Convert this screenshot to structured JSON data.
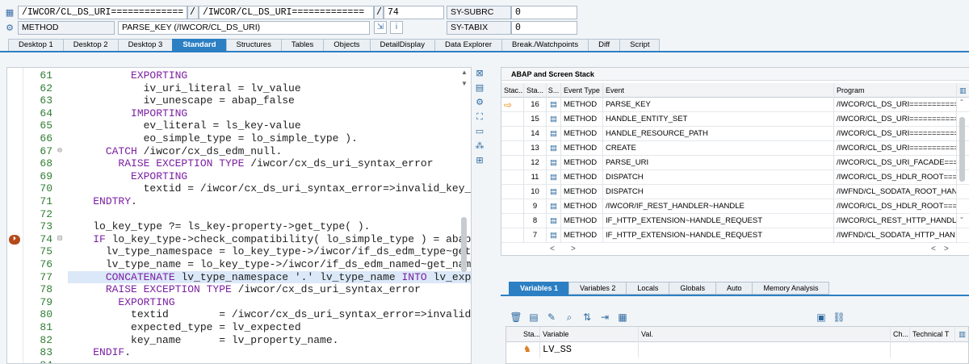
{
  "header": {
    "row1": {
      "program_field": "/IWCOR/CL_DS_URI=============",
      "include_field": "/IWCOR/CL_DS_URI=============",
      "line_field": "74",
      "sysvar_label": "SY-SUBRC",
      "sysvar_value": "0"
    },
    "row2": {
      "event_type": "METHOD",
      "event_name": "PARSE_KEY (/IWCOR/CL_DS_URI)",
      "sysvar_label": "SY-TABIX",
      "sysvar_value": "0"
    }
  },
  "tabs": [
    "Desktop 1",
    "Desktop 2",
    "Desktop 3",
    "Standard",
    "Structures",
    "Tables",
    "Objects",
    "DetailDisplay",
    "Data Explorer",
    "Break./Watchpoints",
    "Diff",
    "Script"
  ],
  "active_tab": "Standard",
  "code": [
    {
      "n": "61",
      "fold": "",
      "indent": "          ",
      "parts": [
        [
          "kw",
          "EXPORTING"
        ]
      ]
    },
    {
      "n": "62",
      "fold": "",
      "indent": "            ",
      "parts": [
        [
          "",
          "iv_uri_literal = lv_value"
        ]
      ]
    },
    {
      "n": "63",
      "fold": "",
      "indent": "            ",
      "parts": [
        [
          "",
          "iv_unescape = abap_false"
        ]
      ]
    },
    {
      "n": "64",
      "fold": "",
      "indent": "          ",
      "parts": [
        [
          "kw",
          "IMPORTING"
        ]
      ]
    },
    {
      "n": "65",
      "fold": "",
      "indent": "            ",
      "parts": [
        [
          "",
          "ev_literal = ls_key-value"
        ]
      ]
    },
    {
      "n": "66",
      "fold": "",
      "indent": "            ",
      "parts": [
        [
          "",
          "eo_simple_type = lo_simple_type )."
        ]
      ]
    },
    {
      "n": "67",
      "fold": "⊖",
      "indent": "      ",
      "parts": [
        [
          "kw",
          "CATCH"
        ],
        [
          "",
          " /iwcor/cx_ds_edm_null."
        ]
      ]
    },
    {
      "n": "68",
      "fold": "",
      "indent": "        ",
      "parts": [
        [
          "kw",
          "RAISE EXCEPTION TYPE"
        ],
        [
          "",
          " /iwcor/cx_ds_uri_syntax_error"
        ]
      ]
    },
    {
      "n": "69",
      "fold": "",
      "indent": "          ",
      "parts": [
        [
          "kw",
          "EXPORTING"
        ]
      ]
    },
    {
      "n": "70",
      "fold": "",
      "indent": "            ",
      "parts": [
        [
          "",
          "textid = /iwcor/cx_ds_uri_syntax_error=>invalid_key_"
        ]
      ]
    },
    {
      "n": "71",
      "fold": "",
      "indent": "    ",
      "parts": [
        [
          "kw",
          "ENDTRY"
        ],
        [
          "",
          "."
        ]
      ]
    },
    {
      "n": "72",
      "fold": "",
      "indent": "",
      "parts": [
        [
          "",
          ""
        ]
      ]
    },
    {
      "n": "73",
      "fold": "",
      "indent": "    ",
      "parts": [
        [
          "",
          "lo_key_type ?= ls_key-property->get_type( )."
        ]
      ]
    },
    {
      "n": "74",
      "fold": "⊟",
      "indent": "    ",
      "parts": [
        [
          "kw",
          "IF"
        ],
        [
          "",
          " lo_key_type->check_compatibility( lo_simple_type ) = abap_"
        ]
      ],
      "bp": true
    },
    {
      "n": "75",
      "fold": "",
      "indent": "      ",
      "parts": [
        [
          "",
          "lv_type_namespace = lo_key_type->/iwcor/if_ds_edm_type~get"
        ]
      ]
    },
    {
      "n": "76",
      "fold": "",
      "indent": "      ",
      "parts": [
        [
          "",
          "lv_type_name = lo_key_type->/iwcor/if_ds_edm_named~get_nam"
        ]
      ]
    },
    {
      "n": "77",
      "fold": "",
      "indent": "      ",
      "parts": [
        [
          "kw",
          "CONCATENATE"
        ],
        [
          "",
          " lv_type_namespace '.' lv_type_name "
        ],
        [
          "kw",
          "INTO"
        ],
        [
          "",
          " lv_exp"
        ]
      ],
      "hl": true
    },
    {
      "n": "78",
      "fold": "",
      "indent": "      ",
      "parts": [
        [
          "kw",
          "RAISE EXCEPTION TYPE"
        ],
        [
          "",
          " /iwcor/cx_ds_uri_syntax_error"
        ]
      ]
    },
    {
      "n": "79",
      "fold": "",
      "indent": "        ",
      "parts": [
        [
          "kw",
          "EXPORTING"
        ]
      ]
    },
    {
      "n": "80",
      "fold": "",
      "indent": "          ",
      "parts": [
        [
          "",
          "textid        = /iwcor/cx_ds_uri_syntax_error=>invalid"
        ]
      ]
    },
    {
      "n": "81",
      "fold": "",
      "indent": "          ",
      "parts": [
        [
          "",
          "expected_type = lv_expected"
        ]
      ]
    },
    {
      "n": "82",
      "fold": "",
      "indent": "          ",
      "parts": [
        [
          "",
          "key_name      = lv_property_name."
        ]
      ]
    },
    {
      "n": "83",
      "fold": "",
      "indent": "    ",
      "parts": [
        [
          "kw",
          "ENDIF"
        ],
        [
          "",
          "."
        ]
      ]
    },
    {
      "n": "84",
      "fold": "",
      "indent": "",
      "parts": [
        [
          "",
          ""
        ]
      ]
    }
  ],
  "stack": {
    "title": "ABAP and Screen Stack",
    "headers": {
      "stack": "Stac...",
      "sta": "Sta...",
      "s": "S...",
      "event_type": "Event Type",
      "event": "Event",
      "program": "Program"
    },
    "rows": [
      {
        "current": true,
        "level": "16",
        "type": "METHOD",
        "event": "PARSE_KEY",
        "program": "/IWCOR/CL_DS_URI============"
      },
      {
        "current": false,
        "level": "15",
        "type": "METHOD",
        "event": "HANDLE_ENTITY_SET",
        "program": "/IWCOR/CL_DS_URI============"
      },
      {
        "current": false,
        "level": "14",
        "type": "METHOD",
        "event": "HANDLE_RESOURCE_PATH",
        "program": "/IWCOR/CL_DS_URI============"
      },
      {
        "current": false,
        "level": "13",
        "type": "METHOD",
        "event": "CREATE",
        "program": "/IWCOR/CL_DS_URI============"
      },
      {
        "current": false,
        "level": "12",
        "type": "METHOD",
        "event": "PARSE_URI",
        "program": "/IWCOR/CL_DS_URI_FACADE===="
      },
      {
        "current": false,
        "level": "11",
        "type": "METHOD",
        "event": "DISPATCH",
        "program": "/IWCOR/CL_DS_HDLR_ROOT====="
      },
      {
        "current": false,
        "level": "10",
        "type": "METHOD",
        "event": "DISPATCH",
        "program": "/IWFND/CL_SODATA_ROOT_HAN"
      },
      {
        "current": false,
        "level": "9",
        "type": "METHOD",
        "event": "/IWCOR/IF_REST_HANDLER~HANDLE",
        "program": "/IWCOR/CL_DS_HDLR_ROOT====="
      },
      {
        "current": false,
        "level": "8",
        "type": "METHOD",
        "event": "IF_HTTP_EXTENSION~HANDLE_REQUEST",
        "program": "/IWCOR/CL_REST_HTTP_HANDLER"
      },
      {
        "current": false,
        "level": "7",
        "type": "METHOD",
        "event": "IF_HTTP_EXTENSION~HANDLE_REQUEST",
        "program": "/IWFND/CL_SODATA_HTTP_HAN"
      }
    ]
  },
  "variables": {
    "tabs": [
      "Variables 1",
      "Variables 2",
      "Locals",
      "Globals",
      "Auto",
      "Memory Analysis"
    ],
    "active_tab": "Variables 1",
    "headers": {
      "sta": "Sta...",
      "variable": "Variable",
      "value": "Val.",
      "ch": "Ch...",
      "technical": "Technical T"
    },
    "rows": [
      {
        "variable": "LV_SS",
        "value": ""
      }
    ]
  },
  "colors": {
    "accent": "#2c7fc3",
    "keyword": "#7b1fa2",
    "line_number": "#2e7d32",
    "current_arrow": "#e88a12"
  }
}
